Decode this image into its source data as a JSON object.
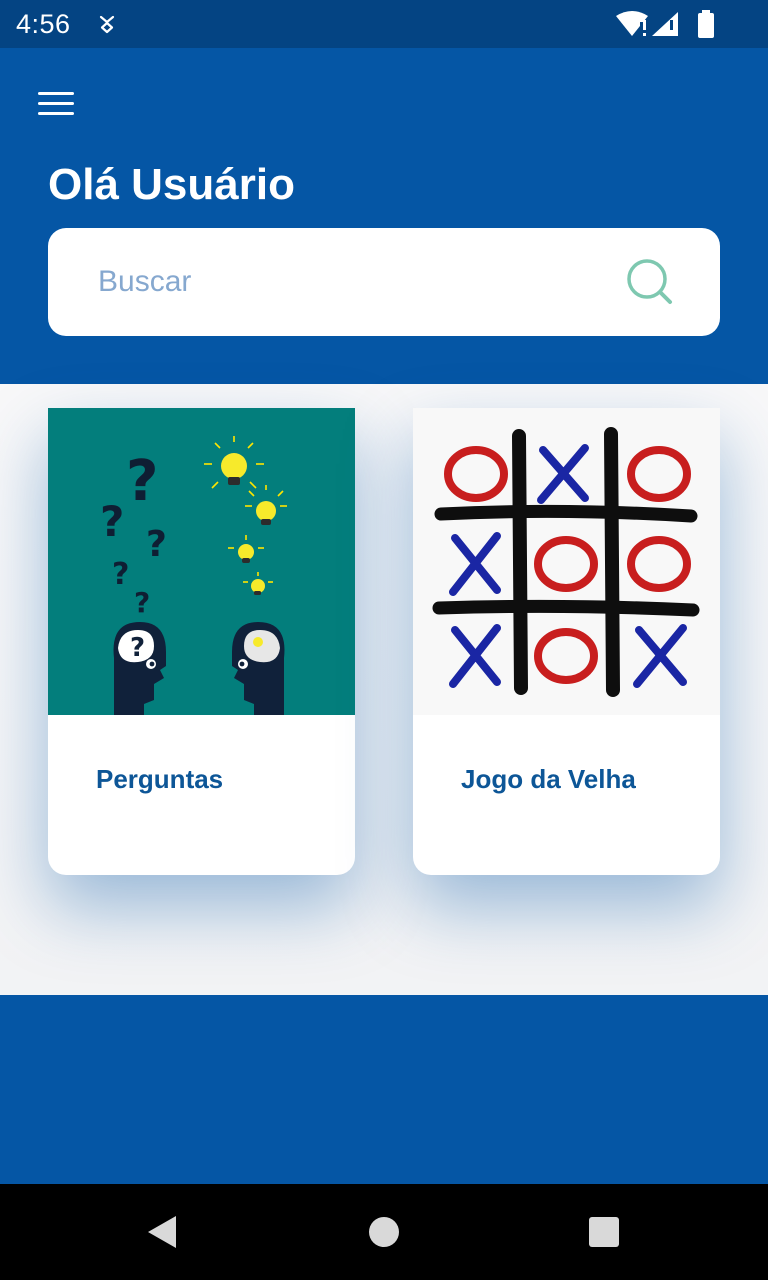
{
  "status_bar": {
    "time": "4:56",
    "icons": [
      "notification-icon",
      "wifi-icon",
      "signal-icon",
      "battery-icon"
    ]
  },
  "header": {
    "menu_icon": "hamburger-menu-icon",
    "greeting": "Olá Usuário",
    "search": {
      "placeholder": "Buscar",
      "value": "",
      "icon": "search-icon"
    }
  },
  "cards": [
    {
      "label": "Perguntas",
      "image": "questions-lightbulbs-illustration"
    },
    {
      "label": "Jogo da Velha",
      "image": "tic-tac-toe-illustration"
    }
  ],
  "nav_bar": {
    "buttons": [
      "back-icon",
      "home-icon",
      "recents-icon"
    ]
  },
  "colors": {
    "primary": "#0556a5",
    "status_bar": "#044483",
    "card_title": "#0d5697",
    "search_icon": "#7ec8b0",
    "placeholder": "#86a8cf",
    "teal_image_bg": "#037e7c",
    "tic_o": "#c81e1e",
    "tic_x": "#1a26a4"
  }
}
